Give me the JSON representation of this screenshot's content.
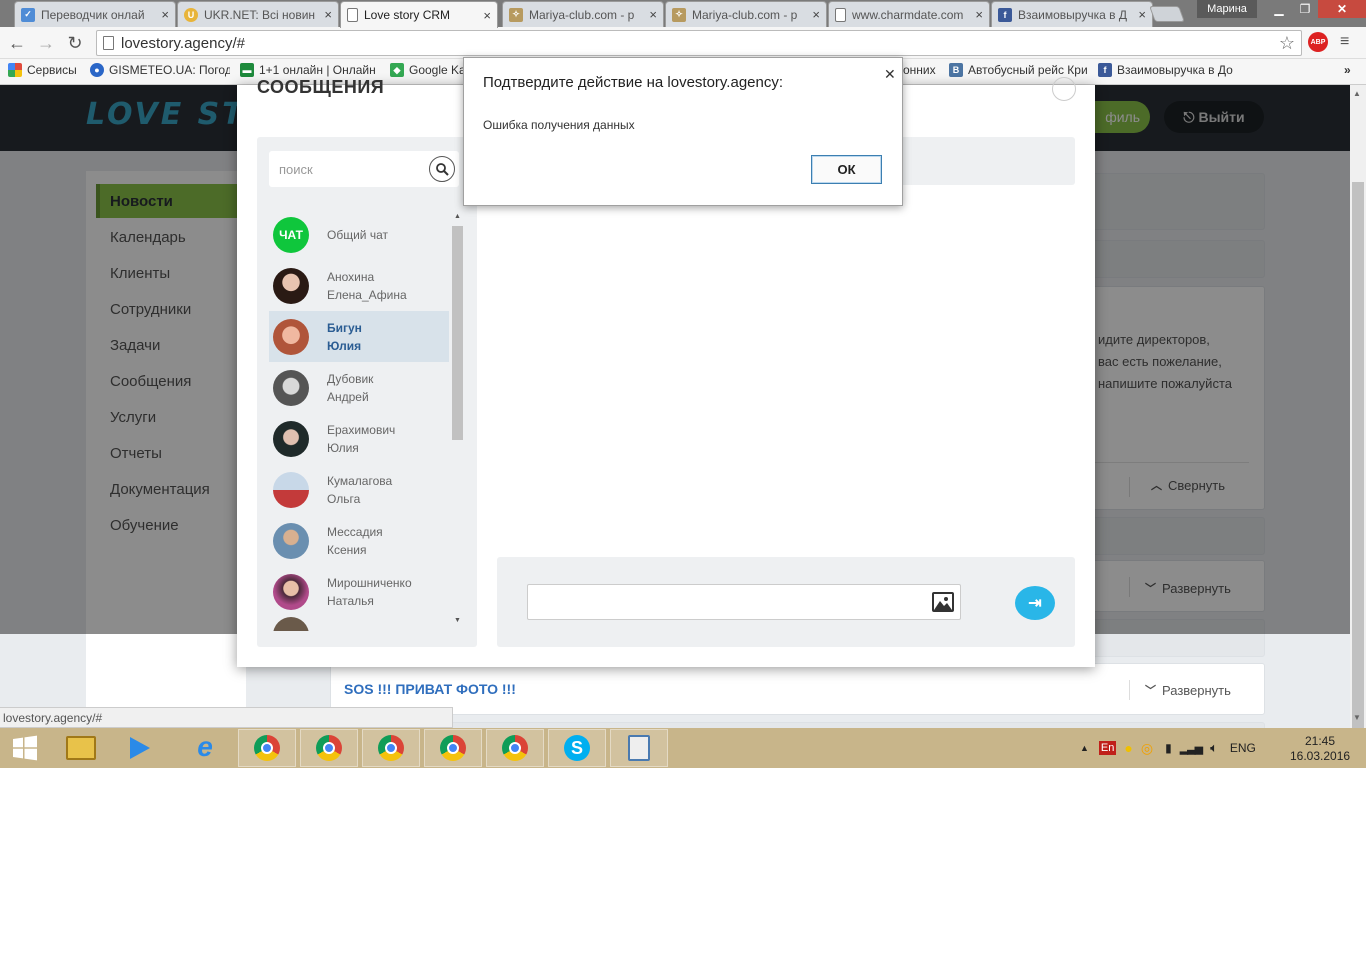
{
  "browser": {
    "tabs": [
      {
        "title": "Переводчик онлай",
        "icon": "translate-icon",
        "color": "#4f8cd6"
      },
      {
        "title": "UKR.NET: Всі новин",
        "icon": "ukrnet-icon",
        "color": "#e8b43a"
      },
      {
        "title": "Love story CRM",
        "icon": "page-icon",
        "color": "#ffffff"
      },
      {
        "title": "Mariya-club.com - p",
        "icon": "mariya-club-icon",
        "color": "#b79a5f"
      },
      {
        "title": "Mariya-club.com - p",
        "icon": "mariya-club-icon",
        "color": "#b79a5f"
      },
      {
        "title": "www.charmdate.com",
        "icon": "page-icon",
        "color": "#ffffff"
      },
      {
        "title": "Взаимовыручка в Д",
        "icon": "facebook-icon",
        "color": "#3b5998"
      }
    ],
    "user_label": "Марина",
    "url": "lovestory.agency/#",
    "abp_label": "ABP",
    "bookmarks": [
      {
        "label": "Сервисы",
        "icon": "apps-icon",
        "color": "#e04a3c"
      },
      {
        "label": "GISMETEO.UA: Погод",
        "icon": "gismeteo-icon",
        "color": "#2a66c7"
      },
      {
        "label": "1+1 онлайн | Онлайн",
        "icon": "tv-icon",
        "color": "#1e8a3c"
      },
      {
        "label": "Google Ka",
        "icon": "google-maps-icon",
        "color": "#34a853"
      },
      {
        "label": "онних",
        "icon": "page-icon",
        "color": "#888888"
      },
      {
        "label": "Автобусный рейс Кри",
        "icon": "vk-icon",
        "color": "#4c75a3"
      },
      {
        "label": "Взаимовыручка в До",
        "icon": "facebook-icon",
        "color": "#3b5998"
      }
    ]
  },
  "app": {
    "logo": "LOVE STO",
    "profile_label": "филь",
    "logout_label": "Выйти",
    "sidebar": [
      {
        "label": "Новости",
        "active": true
      },
      {
        "label": "Календарь"
      },
      {
        "label": "Клиенты"
      },
      {
        "label": "Сотрудники"
      },
      {
        "label": "Задачи"
      },
      {
        "label": "Сообщения"
      },
      {
        "label": "Услуги"
      },
      {
        "label": "Отчеты"
      },
      {
        "label": "Документация"
      },
      {
        "label": "Обучение"
      }
    ],
    "news_text": [
      "идите директоров,",
      "вас есть пожелание,",
      "напишите пожалуйста"
    ],
    "collapse_label": "Свернуть",
    "expand_label": "Развернуть",
    "expand_label_2": "Развернуть",
    "sos_title": "SOS !!! ПРИВАТ ФОТО !!!"
  },
  "messages_modal": {
    "title": "СООБЩЕНИЯ",
    "search_placeholder": "поиск",
    "contacts": [
      {
        "first": "Общий чат",
        "last": "",
        "avatar": "ЧАТ"
      },
      {
        "first": "Анохина",
        "last": "Елена_Афина",
        "color": "#7a4a3a"
      },
      {
        "first": "Бигун",
        "last": "Юлия",
        "color": "#c0624a",
        "active": true
      },
      {
        "first": "Дубовик",
        "last": "Андрей",
        "color": "#8a8a8a"
      },
      {
        "first": "Ерахимович",
        "last": "Юлия",
        "color": "#3a5a4a"
      },
      {
        "first": "Кумалагова",
        "last": "Ольга",
        "color": "#c33a3a"
      },
      {
        "first": "Мессадия",
        "last": "Ксения",
        "color": "#6a8fb0"
      },
      {
        "first": "Мирошниченко",
        "last": "Наталья",
        "color": "#4a3a5a"
      },
      {
        "first": "",
        "last": "",
        "color": "#6a5a4a"
      }
    ]
  },
  "alert": {
    "title": "Подтвердите действие на lovestory.agency:",
    "message": "Ошибка получения данных",
    "ok_label": "ОК"
  },
  "status_url": "lovestory.agency/#",
  "taskbar": {
    "lang_indicator": "En",
    "lang": "ENG",
    "time": "21:45",
    "date": "16.03.2016"
  }
}
